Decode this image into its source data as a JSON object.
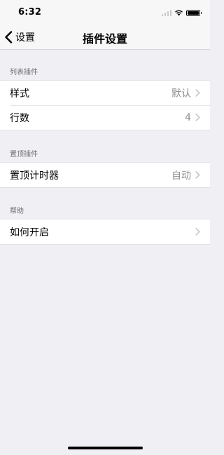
{
  "status_bar": {
    "time": "6:32",
    "icons": [
      "signal-icon",
      "wifi-icon",
      "battery-icon"
    ]
  },
  "nav": {
    "back_label": "设置",
    "title": "插件设置"
  },
  "sections": [
    {
      "header": "列表插件",
      "rows": [
        {
          "label": "样式",
          "value": "默认"
        },
        {
          "label": "行数",
          "value": "4"
        }
      ]
    },
    {
      "header": "置顶插件",
      "rows": [
        {
          "label": "置顶计时器",
          "value": "自动"
        }
      ]
    },
    {
      "header": "帮助",
      "rows": [
        {
          "label": "如何开启",
          "value": ""
        }
      ]
    }
  ],
  "colors": {
    "background": "#efeff4",
    "secondary_text": "#8e8e93",
    "section_header": "#6d6d72"
  }
}
